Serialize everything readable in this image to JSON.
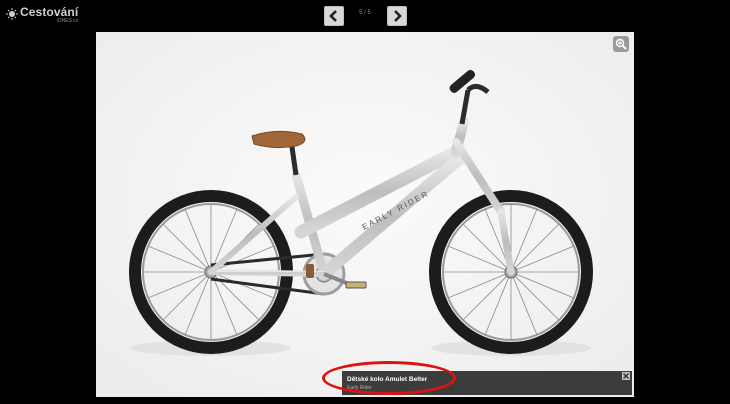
{
  "logo": {
    "name": "Cestování",
    "sub": "iDNES.cz",
    "icon": "sun-logo-icon"
  },
  "nav": {
    "prev_icon": "chevron-left-icon",
    "next_icon": "chevron-right-icon",
    "counter": "5 / 5"
  },
  "photo": {
    "zoom_icon": "zoom-in-icon",
    "frame_brand": "EARLY RIDER"
  },
  "caption": {
    "title": "Dětské kolo Amulet Belter",
    "credit": "Early Rider",
    "close_icon": "close-icon"
  },
  "colors": {
    "background": "#000000",
    "caption_bg": "#3c3c3c",
    "highlight": "#e01010",
    "frame": "#c9c9c9",
    "saddle": "#a0683a"
  }
}
